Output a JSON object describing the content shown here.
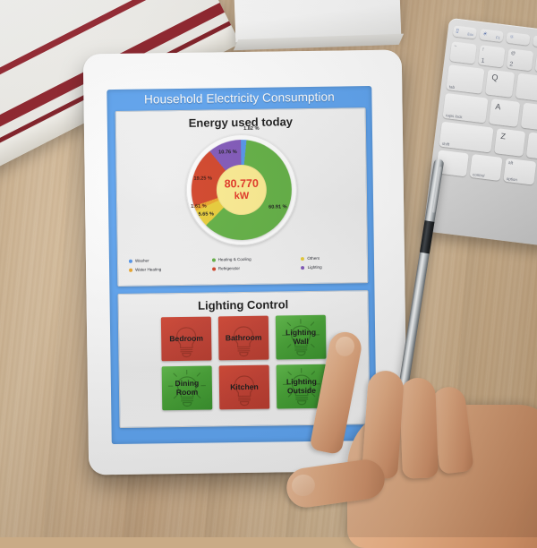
{
  "scene": {
    "description": "tablet-on-desk-smart-home-app",
    "objects": [
      "wooden-desk",
      "striped-book",
      "white-paper-box",
      "apple-keyboard",
      "silver-pen",
      "hand-touching-screen"
    ]
  },
  "app": {
    "title": "Household Electricity Consumption",
    "accent_color": "#58a0ef"
  },
  "energy_panel": {
    "title": "Energy used today",
    "center_value": "80.770",
    "center_unit": "kW",
    "center_text_color": "#e02b1a",
    "center_bg_color": "#fae98a"
  },
  "chart_data": {
    "type": "pie",
    "title": "Energy used today",
    "subtitle": "",
    "xlabel": "",
    "ylabel": "",
    "donut": true,
    "legend_position": "bottom",
    "grid": false,
    "center_label": "80.770 kW",
    "total_kw": 80.77,
    "unit": "%",
    "start_angle_deg": 0,
    "direction": "clockwise",
    "categories": [
      "Washer",
      "Heating & Cooling",
      "Others",
      "Water Heating",
      "Refrigerator",
      "Lighting"
    ],
    "values": [
      1.82,
      60.91,
      5.65,
      1.61,
      19.25,
      10.76
    ],
    "labels": [
      "1.82 %",
      "60.91 %",
      "5.65 %",
      "1.61 %",
      "19.25 %",
      "10.76 %"
    ],
    "colors": [
      "#4b8fe8",
      "#5aab3a",
      "#e6c92e",
      "#e8a020",
      "#cf3a1e",
      "#7a4fb5"
    ],
    "slices": [
      {
        "name": "Washer",
        "value": 1.82,
        "label": "1.82 %",
        "color": "#4b8fe8"
      },
      {
        "name": "Heating & Cooling",
        "value": 60.91,
        "label": "60.91 %",
        "color": "#5aab3a"
      },
      {
        "name": "Others",
        "value": 5.65,
        "label": "5.65 %",
        "color": "#e6c92e"
      },
      {
        "name": "Water Heating",
        "value": 1.61,
        "label": "1.61 %",
        "color": "#e8a020"
      },
      {
        "name": "Refrigerator",
        "value": 19.25,
        "label": "19.25 %",
        "color": "#cf3a1e"
      },
      {
        "name": "Lighting",
        "value": 10.76,
        "label": "10.76 %",
        "color": "#7a4fb5"
      }
    ]
  },
  "legend": [
    {
      "label": "Washer",
      "color": "#4b8fe8"
    },
    {
      "label": "Heating & Cooling",
      "color": "#5aab3a"
    },
    {
      "label": "Others",
      "color": "#e6c92e"
    },
    {
      "label": "Water Heating",
      "color": "#e8a020"
    },
    {
      "label": "Refrigerator",
      "color": "#cf3a1e"
    },
    {
      "label": "Lighting",
      "color": "#7a4fb5"
    }
  ],
  "lighting_panel": {
    "title": "Lighting Control",
    "on_color": "#3f9d2d",
    "off_color": "#c0392b",
    "buttons": [
      {
        "label": "Bedroom",
        "state": "off"
      },
      {
        "label": "Bathroom",
        "state": "off"
      },
      {
        "label": "Lighting Wall",
        "state": "on"
      },
      {
        "label": "Dining Room",
        "state": "on"
      },
      {
        "label": "Kitchen",
        "state": "off"
      },
      {
        "label": "Lighting Outside",
        "state": "on"
      }
    ]
  },
  "keyboard": {
    "keys": [
      "Esc",
      "F1",
      "~",
      "1",
      "2",
      "tab",
      "Q",
      "caps lock",
      "A",
      "shift",
      "Z",
      "fn",
      "control",
      "alt",
      "option"
    ]
  }
}
